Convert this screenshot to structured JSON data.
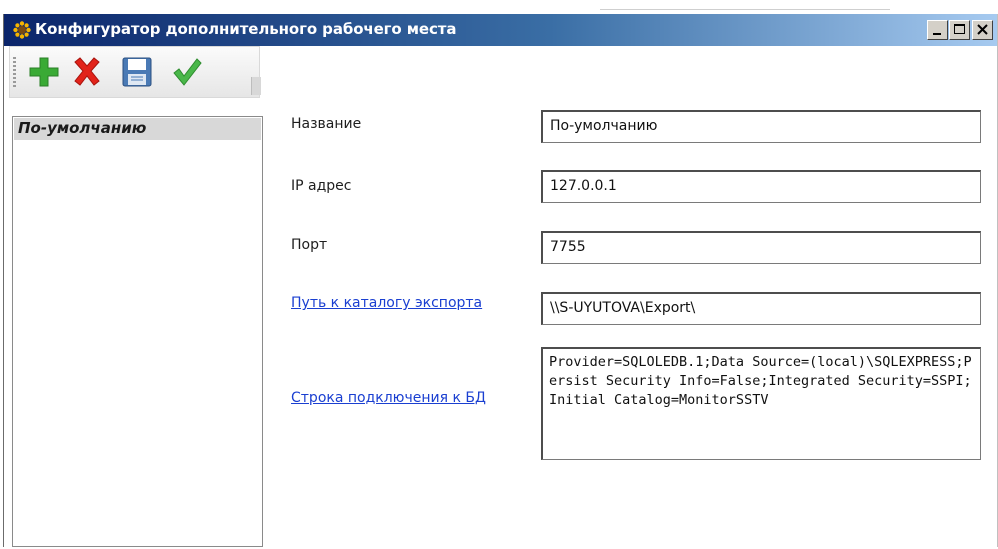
{
  "window": {
    "title": "Конфигуратор дополнительного рабочего места",
    "controls": [
      "minimize",
      "maximize",
      "close"
    ]
  },
  "toolbar": {
    "buttons": [
      {
        "name": "add",
        "icon": "plus-icon",
        "color": "#3aaa35"
      },
      {
        "name": "delete",
        "icon": "x-icon",
        "color": "#e2231a"
      },
      {
        "name": "save",
        "icon": "floppy-disk-icon",
        "color": "#4a7ab5"
      },
      {
        "name": "apply",
        "icon": "checkmark-icon",
        "color": "#49b749"
      }
    ]
  },
  "list": {
    "items": [
      {
        "label": "По-умолчанию",
        "selected": true
      }
    ]
  },
  "form": {
    "name_label": "Название",
    "name_value": "По-умолчанию",
    "ip_label": "IP адрес",
    "ip_value": "127.0.0.1",
    "port_label": "Порт",
    "port_value": "7755",
    "export_label": "Путь к каталогу экспорта",
    "export_value": "\\\\S-UYUTOVA\\Export\\",
    "conn_label": "Строка подключения к БД",
    "conn_value": "Provider=SQLOLEDB.1;Data Source=(local)\\SQLEXPRESS;Persist Security Info=False;Integrated Security=SSPI;Initial Catalog=MonitorSSTV"
  },
  "colors": {
    "titlebar_start": "#0a246a",
    "titlebar_end": "#a6caf0",
    "link": "#1a3fd1",
    "selection": "#d8d8d8"
  }
}
